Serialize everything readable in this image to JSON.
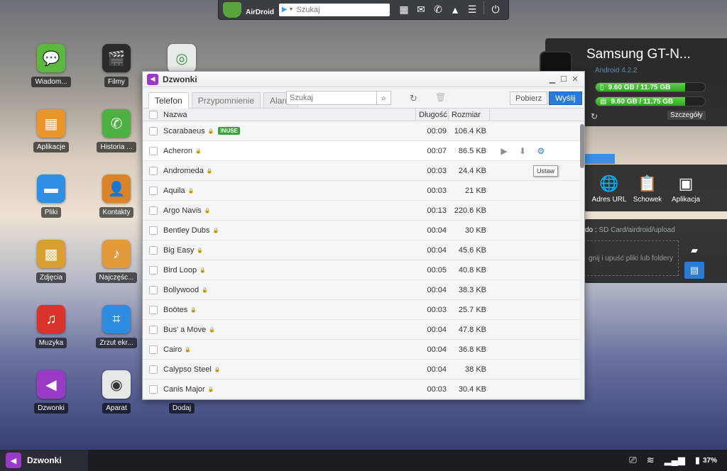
{
  "topbar": {
    "logo_text": "AirDroid",
    "search_placeholder": "Szukaj",
    "icons": [
      "grid-icon",
      "message-icon",
      "phone-icon",
      "bell-icon",
      "menu-icon",
      "power-icon"
    ]
  },
  "desktop": {
    "icons": [
      {
        "label": "Wiadom...",
        "icon": "message-icon",
        "color": "#5cb83c"
      },
      {
        "label": "Filmy",
        "icon": "clapper-icon",
        "color": "#2b2b2b"
      },
      {
        "label": "Aplikacje",
        "icon": "box-icon",
        "color": "#e8952c"
      },
      {
        "label": "Historia ...",
        "icon": "phone-icon",
        "color": "#4bb241"
      },
      {
        "label": "Pliki",
        "icon": "folder-icon",
        "color": "#2f8fe3"
      },
      {
        "label": "Kontakty",
        "icon": "contacts-icon",
        "color": "#d9832a"
      },
      {
        "label": "Zdjęcia",
        "icon": "photo-icon",
        "color": "#d8a030"
      },
      {
        "label": "Najczęśc...",
        "icon": "ringtone-folder-icon",
        "color": "#e39a3a"
      },
      {
        "label": "Muzyka",
        "icon": "music-icon",
        "color": "#d9332b"
      },
      {
        "label": "Zrzut ekr...",
        "icon": "crop-icon",
        "color": "#2d8be0"
      },
      {
        "label": "Dzwonki",
        "icon": "speaker-icon",
        "color": "#9a3bc8"
      },
      {
        "label": "Aparat",
        "icon": "camera-icon",
        "color": "#e8e8e8"
      },
      {
        "label": "Dodaj",
        "icon": "add-icon",
        "color": "#4a9d5a"
      }
    ]
  },
  "device": {
    "name": "Samsung GT-N...",
    "version": "Android 4.2.2",
    "storage": [
      {
        "label": "9.60 GB / 11.75 GB",
        "fraction": 0.82
      },
      {
        "label": "9.60 GB / 11.75 GB",
        "fraction": 0.82
      }
    ],
    "details_label": "Szczegóły"
  },
  "tools": [
    {
      "label": "Adres URL",
      "icon": "globe-icon"
    },
    {
      "label": "Schowek",
      "icon": "clipboard-icon"
    },
    {
      "label": "Aplikacja",
      "icon": "app-box-icon"
    }
  ],
  "upload": {
    "title_prefix": "do :",
    "path": "SD Card/airdroid/upload",
    "dropzone": "gnij i upuść pliki lub foldery"
  },
  "window": {
    "title": "Dzwonki",
    "tabs": [
      "Telefon",
      "Przypomnienie",
      "Alarm"
    ],
    "search_placeholder": "Szukaj",
    "download_label": "Pobierz",
    "send_label": "Wyślij",
    "columns": {
      "name": "Nazwa",
      "duration": "Długość",
      "size": "Rozmiar"
    },
    "tooltip": "Ustaw",
    "inuse_label": "INUSE",
    "rows": [
      {
        "name": "Scarabaeus",
        "duration": "00:09",
        "size": "106.4 KB",
        "inuse": true
      },
      {
        "name": "Acheron",
        "duration": "00:07",
        "size": "86.5 KB",
        "hover": true
      },
      {
        "name": "Andromeda",
        "duration": "00:03",
        "size": "24.4 KB"
      },
      {
        "name": "Aquila",
        "duration": "00:03",
        "size": "21 KB"
      },
      {
        "name": "Argo Navis",
        "duration": "00:13",
        "size": "220.6 KB"
      },
      {
        "name": "Bentley Dubs",
        "duration": "00:04",
        "size": "30 KB"
      },
      {
        "name": "Big Easy",
        "duration": "00:04",
        "size": "45.6 KB"
      },
      {
        "name": "Bird Loop",
        "duration": "00:05",
        "size": "40.8 KB"
      },
      {
        "name": "Bollywood",
        "duration": "00:04",
        "size": "38.3 KB"
      },
      {
        "name": "Boötes",
        "duration": "00:03",
        "size": "25.7 KB"
      },
      {
        "name": "Bus' a Move",
        "duration": "00:04",
        "size": "47.8 KB"
      },
      {
        "name": "Cairo",
        "duration": "00:04",
        "size": "36.8 KB"
      },
      {
        "name": "Calypso Steel",
        "duration": "00:04",
        "size": "38 KB"
      },
      {
        "name": "Canis Major",
        "duration": "00:03",
        "size": "30.4 KB"
      }
    ]
  },
  "taskbar": {
    "app_label": "Dzwonki",
    "battery": "37%"
  }
}
